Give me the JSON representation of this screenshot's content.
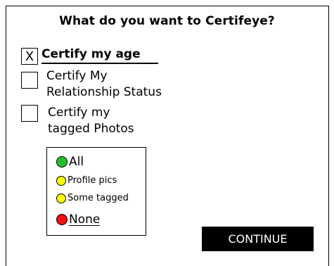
{
  "title": "What do you want to Certifeye?",
  "options": [
    {
      "label": "Certify my age",
      "checked": true,
      "mark": "X"
    },
    {
      "label_lines": [
        "Certify My",
        "Relationship Status"
      ],
      "checked": false,
      "mark": ""
    },
    {
      "label_lines": [
        "Certify my",
        "tagged Photos"
      ],
      "checked": false,
      "mark": ""
    }
  ],
  "legend": {
    "items": [
      {
        "label": "All",
        "color": "#22c22e"
      },
      {
        "label": "Profile pics",
        "color": "#ffff00"
      },
      {
        "label": "Some tagged",
        "color": "#ffff00"
      },
      {
        "label": "None",
        "color": "#ee1111"
      }
    ]
  },
  "continue_label": "CONTINUE"
}
